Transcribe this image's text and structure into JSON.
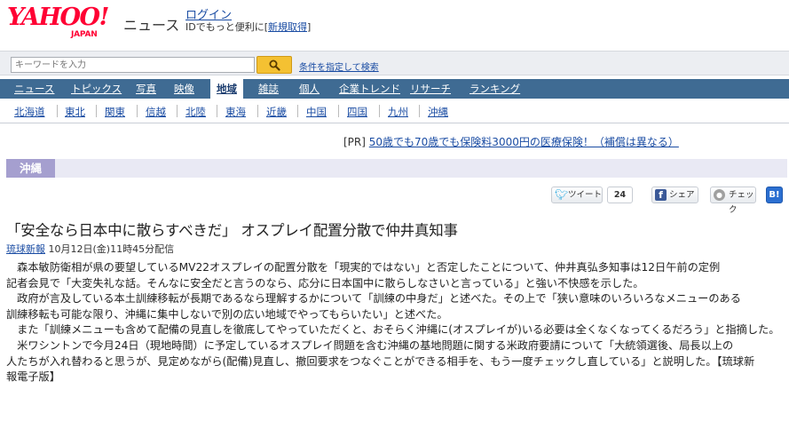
{
  "header": {
    "logo_text": "YAHOO!",
    "logo_sub": "JAPAN",
    "brand": "ニュース",
    "login": "ログイン",
    "login_sub": "IDでもっと便利に[",
    "register": "新規取得",
    "register_end": "]"
  },
  "search": {
    "placeholder": "キーワードを入力",
    "advanced": "条件を指定して検索",
    "icon": "magnifier-icon",
    "accent": "#f4c132"
  },
  "nav": {
    "items": [
      "ニュース",
      "トピックス",
      "写真",
      "映像",
      "地域",
      "雑誌",
      "個人",
      "企業トレンド",
      "リサーチ",
      "ランキング"
    ],
    "active": "地域",
    "bg_color": "#3f6b93"
  },
  "regions": [
    "北海道",
    "東北",
    "関東",
    "信越",
    "北陸",
    "東海",
    "近畿",
    "中国",
    "四国",
    "九州",
    "沖縄"
  ],
  "pr": {
    "prefix": "[PR] ",
    "text": "50歳でも70歳でも保険料3000円の医療保険！（補償は異なる）"
  },
  "category": {
    "label": "沖縄",
    "color": "#a59fcf"
  },
  "social": {
    "tweet": "ツイート",
    "tweet_count": "24",
    "share": "シェア",
    "check": "チェック",
    "hatena": "B!"
  },
  "article": {
    "title": "「安全なら日本中に散らすべきだ」 オスプレイ配置分散で仲井真知事",
    "source": "琉球新報",
    "date": " 10月12日(金)11時45分配信",
    "lines": [
      "　森本敏防衛相が県の要望しているMV22オスプレイの配置分散を「現実的ではない」と否定したことについて、仲井真弘多知事は12日午前の定例",
      "記者会見で「大変失礼な話。そんなに安全だと言うのなら、応分に日本国中に散らしなさいと言っている」と強い不快感を示した。",
      "　政府が言及している本土訓練移転が長期であるなら理解するかについて「訓練の中身だ」と述べた。その上で「狭い意味のいろいろなメニューのある",
      "訓練移転も可能な限り、沖縄に集中しないで別の広い地域でやってもらいたい」と述べた。",
      "　また「訓練メニューも含めて配備の見直しを徹底してやっていただくと、おそらく沖縄に(オスプレイが)いる必要は全くなくなってくるだろう」と指摘した。",
      "　米ワシントンで今月24日（現地時間）に予定しているオスプレイ問題を含む沖縄の基地問題に関する米政府要請について「大統領選後、局長以上の",
      "人たちが入れ替わると思うが、見定めながら(配備)見直し、撤回要求をつなぐことができる相手を、もう一度チェックし直している」と説明した。【琉球新",
      "報電子版】"
    ]
  }
}
